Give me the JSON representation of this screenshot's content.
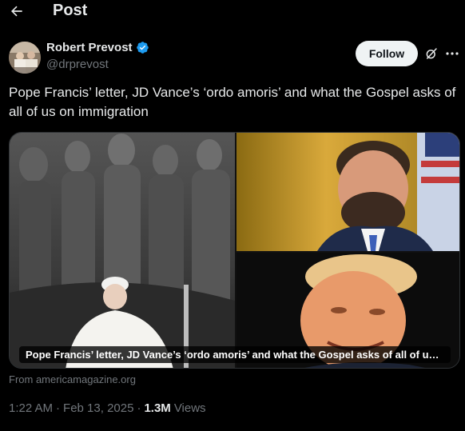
{
  "header": {
    "title": "Post"
  },
  "author": {
    "display_name": "Robert Prevost",
    "handle": "@drprevost"
  },
  "actions": {
    "follow_label": "Follow"
  },
  "post": {
    "text": "Pope Francis’ letter, JD Vance’s ‘ordo amoris’ and what the Gospel asks of all of us on immigration"
  },
  "media": {
    "caption": "Pope Francis’ letter, JD Vance’s ‘ordo amoris’ and what the Gospel asks of all of us on i..."
  },
  "link_source": "From americamagazine.org",
  "meta": {
    "time": "1:22 AM",
    "date": "Feb 13, 2025",
    "separator": "·",
    "views_count": "1.3M",
    "views_label": "Views"
  },
  "colors": {
    "background": "#000000",
    "text_primary": "#e7e9ea",
    "text_secondary": "#71767b",
    "verified_blue": "#1d9bf0",
    "follow_bg": "#eff3f4"
  },
  "icons": {
    "back": "arrow-left-icon",
    "verified": "verified-badge-icon",
    "grok": "grok-icon",
    "more": "more-icon"
  }
}
